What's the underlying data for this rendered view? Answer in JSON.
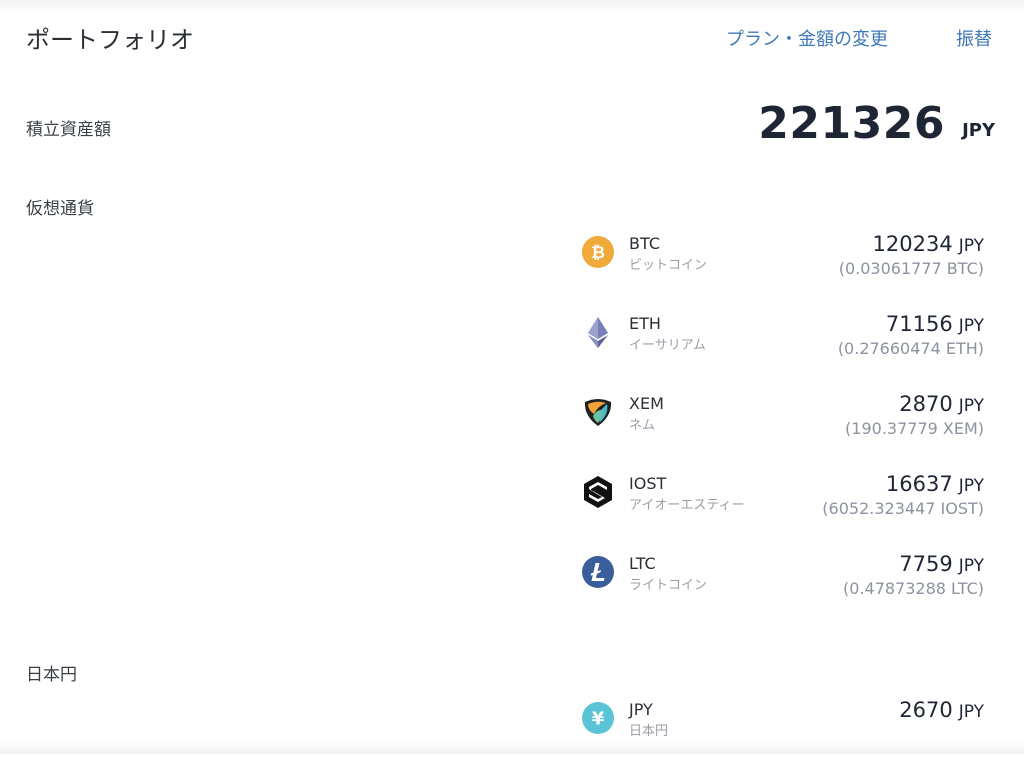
{
  "header": {
    "title": "ポートフォリオ",
    "plan_link": "プラン・金額の変更",
    "transfer_link": "振替"
  },
  "total": {
    "label": "積立資産額",
    "value": "221326",
    "unit": "JPY"
  },
  "crypto": {
    "label": "仮想通貨",
    "items": [
      {
        "code": "BTC",
        "name": "ビットコイン",
        "amount": "120234",
        "unit": "JPY",
        "quantity": "(0.03061777 BTC)",
        "icon": "bitcoin-icon",
        "color": "#f0a93b"
      },
      {
        "code": "ETH",
        "name": "イーサリアム",
        "amount": "71156",
        "unit": "JPY",
        "quantity": "(0.27660474 ETH)",
        "icon": "ethereum-icon",
        "color": "#6b6fa8"
      },
      {
        "code": "XEM",
        "name": "ネム",
        "amount": "2870",
        "unit": "JPY",
        "quantity": "(190.37779 XEM)",
        "icon": "nem-icon",
        "color": "#f2a33a"
      },
      {
        "code": "IOST",
        "name": "アイオーエスティー",
        "amount": "16637",
        "unit": "JPY",
        "quantity": "(6052.323447 IOST)",
        "icon": "iost-icon",
        "color": "#111111"
      },
      {
        "code": "LTC",
        "name": "ライトコイン",
        "amount": "7759",
        "unit": "JPY",
        "quantity": "(0.47873288 LTC)",
        "icon": "litecoin-icon",
        "color": "#3a5d9c"
      }
    ]
  },
  "fiat": {
    "label": "日本円",
    "items": [
      {
        "code": "JPY",
        "name": "日本円",
        "amount": "2670",
        "unit": "JPY",
        "icon": "yen-icon",
        "color": "#5bc3d6"
      }
    ]
  }
}
